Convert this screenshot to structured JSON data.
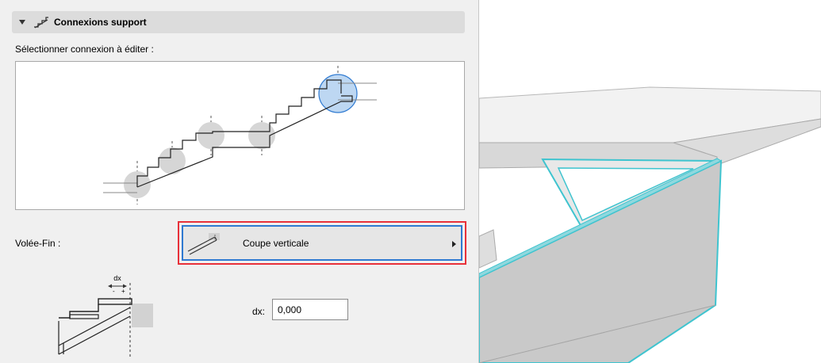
{
  "panel": {
    "section_title": "Connexions support",
    "select_label": "Sélectionner connexion à éditer :",
    "volee_fin_label": "Volée-Fin :",
    "dropdown_value": "Coupe verticale",
    "dx_label": "dx:",
    "dx_value": "0,000",
    "detail_dx_text": "dx",
    "colors": {
      "highlight_red": "#e8313a",
      "selected_blue": "#2f7ad1",
      "edge_cyan": "#3fc4cf"
    }
  },
  "icons": {
    "section_toggle": "triangle-down-icon",
    "section_icon": "stair-support-icon",
    "dropdown_icon": "vertical-cut-icon",
    "dropdown_arrow": "triangle-right-icon"
  }
}
